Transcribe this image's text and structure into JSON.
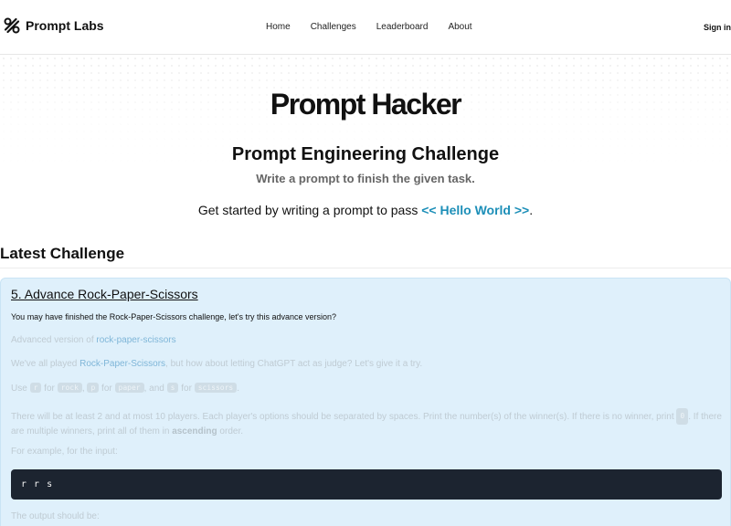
{
  "brand": {
    "name": "Prompt Labs",
    "icon": "prompt-labs-logo-icon"
  },
  "nav": {
    "links": [
      "Home",
      "Challenges",
      "Leaderboard",
      "About"
    ],
    "signin": "Sign in"
  },
  "hero": {
    "title": "Prompt Hacker",
    "subtitle": "Prompt Engineering Challenge",
    "tagline": "Write a prompt to finish the given task.",
    "cta_prefix": "Get started by writing a prompt to pass ",
    "cta_link": "<< Hello World >>",
    "cta_suffix": "."
  },
  "latest": {
    "heading": "Latest Challenge",
    "card": {
      "title": "5. Advance Rock-Paper-Scissors",
      "desc": "You may have finished the Rock-Paper-Scissors challenge, let's try this advance version?",
      "p1_prefix": "Advanced version of ",
      "p1_link": "rock-paper-scissors",
      "p2_prefix": "We've all played ",
      "p2_link": "Rock-Paper-Scissors",
      "p2_suffix": ", but how about letting ChatGPT act as judge? Let's give it a try.",
      "p3_use": "Use ",
      "p3_code_r": "r",
      "p3_for1": " for ",
      "p3_code_rock": "rock",
      "p3_comma1": ", ",
      "p3_code_p": "p",
      "p3_for2": " for ",
      "p3_code_paper": "paper",
      "p3_and": ", and ",
      "p3_code_s": "s",
      "p3_for3": " for ",
      "p3_code_scissors": "scissors",
      "p3_end": ".",
      "p4_a": "There will be at least 2 and at most 10 players. Each player's options should be separated by spaces. Print the number(s) of the winner(s). If there is no winner, print ",
      "p4_code": "0",
      "p4_b": ". If there are multiple winners, print all of them in ",
      "p4_bold": "ascending",
      "p4_c": " order.",
      "p5": "For example, for the input:",
      "code": "r r s",
      "p6": "The output should be:"
    }
  },
  "colors": {
    "accent": "#1d8fb8",
    "card_bg": "#dff0fb",
    "code_bg": "#1c2430"
  }
}
